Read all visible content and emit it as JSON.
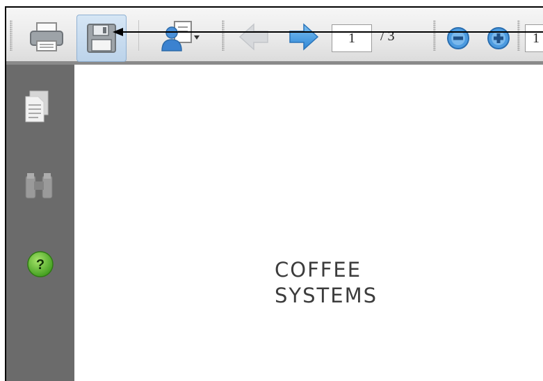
{
  "toolbar": {
    "print_icon": "printer-icon",
    "save_icon": "floppy-disk-icon",
    "share_icon": "user-document-icon",
    "prev_icon": "arrow-left-icon",
    "next_icon": "arrow-right-icon",
    "page_current": "1",
    "page_total": "/ 3",
    "zoom_out_icon": "minus-circle-icon",
    "zoom_in_icon": "plus-circle-icon",
    "zoom_value": "1"
  },
  "sidebar": {
    "items": [
      {
        "icon": "pages-icon"
      },
      {
        "icon": "binoculars-icon"
      },
      {
        "icon": "help-icon",
        "label": "?"
      }
    ]
  },
  "document": {
    "logo_line1": "COFFEE",
    "logo_line2": "SYSTEMS"
  },
  "colors": {
    "accent": "#3b8ad8",
    "sidebar": "#6b6b6b",
    "help": "#5cb82a"
  }
}
